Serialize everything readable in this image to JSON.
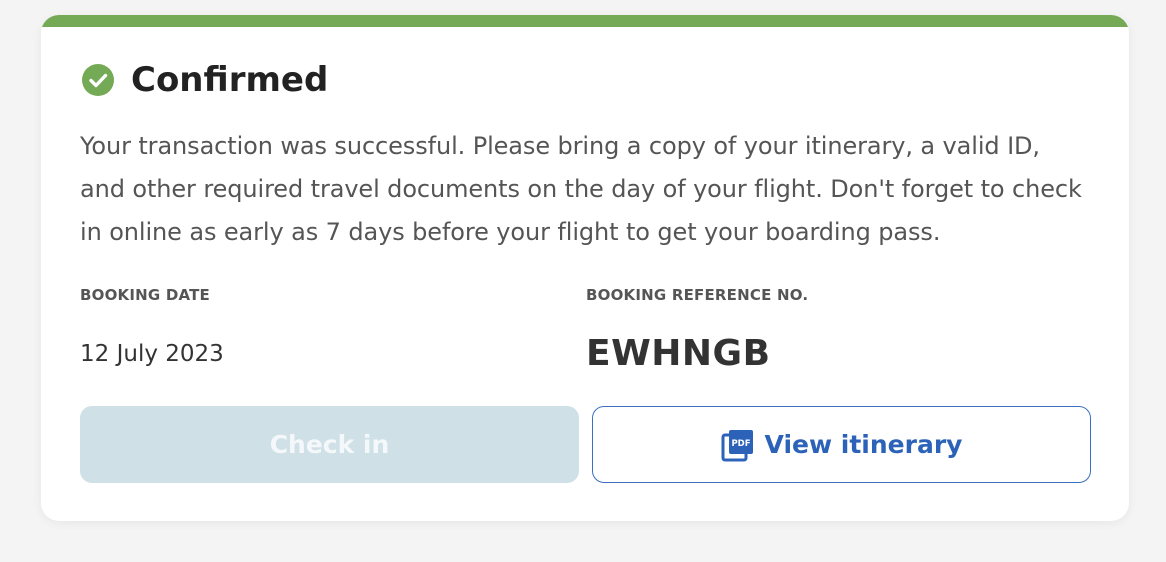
{
  "colors": {
    "accent_success": "#74aa55",
    "link_blue": "#2c63b8",
    "disabled_button": "#cfe0e7"
  },
  "status": {
    "icon": "check-circle-icon",
    "title": "Confirmed"
  },
  "message": "Your transaction was successful. Please bring a copy of your itinerary, a valid ID, and other required travel documents on the day of your flight. Don't forget to check in online as early as 7 days before your flight to get your boarding pass.",
  "booking": {
    "date_label": "BOOKING DATE",
    "date_value": "12 July 2023",
    "ref_label": "BOOKING REFERENCE NO.",
    "ref_value": "EWHNGB"
  },
  "actions": {
    "checkin_label": "Check in",
    "checkin_state": "disabled",
    "itinerary_label": "View itinerary",
    "itinerary_icon": "pdf-icon"
  }
}
